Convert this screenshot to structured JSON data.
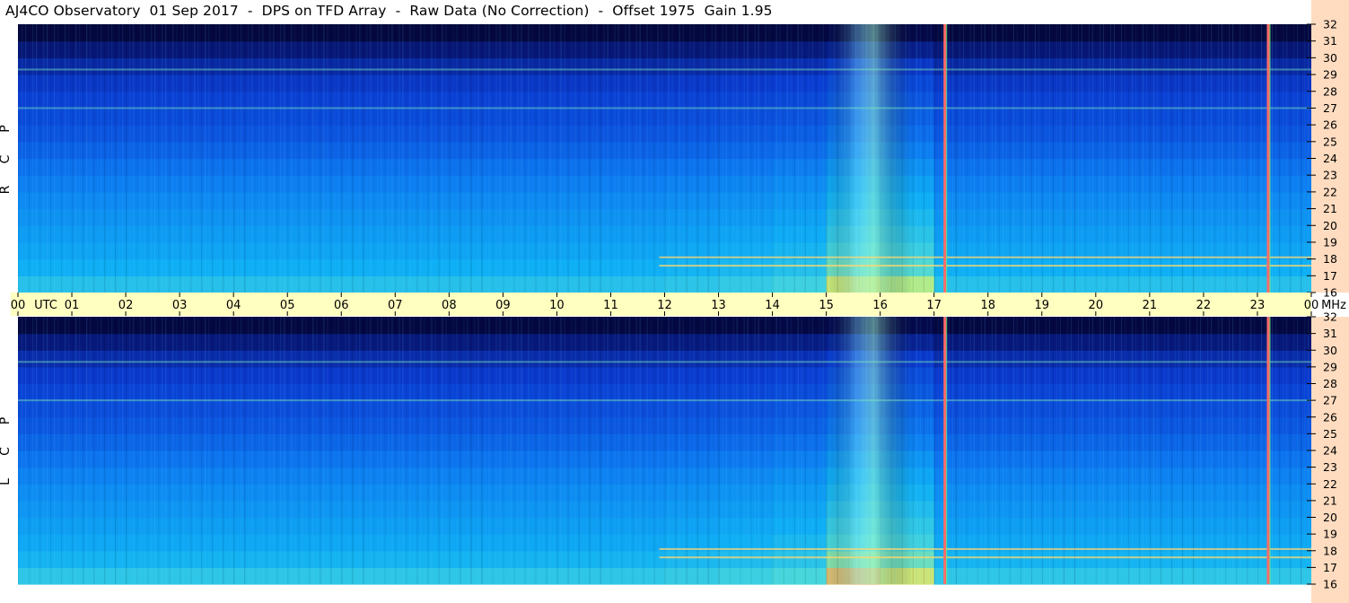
{
  "title": "AJ4CO Observatory  01 Sep 2017  -  DPS on TFD Array  -  Raw Data (No Correction)  -  Offset 1975  Gain 1.95",
  "colors": {
    "time_axis_bg": "#ffffc0",
    "freq_axis_bg": "#ffdcc0",
    "spectrum_low": "#000010",
    "spectrum_mid": "#0a64ff",
    "spectrum_high": "#ff6060",
    "interference_line": "#ff6a6a"
  },
  "chart_data": {
    "type": "heatmap",
    "title": "AJ4CO Observatory  01 Sep 2017  -  DPS on TFD Array  -  Raw Data (No Correction)  -  Offset 1975  Gain 1.95",
    "x_axis": {
      "unit_label": "UTC",
      "ticks": [
        "00",
        "01",
        "02",
        "03",
        "04",
        "05",
        "06",
        "07",
        "08",
        "09",
        "10",
        "11",
        "12",
        "13",
        "14",
        "15",
        "16",
        "17",
        "18",
        "19",
        "20",
        "21",
        "22",
        "23",
        "00"
      ],
      "range_hours": [
        0,
        24
      ]
    },
    "y_axis": {
      "unit_label": "MHz",
      "ticks": [
        "16",
        "17",
        "18",
        "19",
        "20",
        "21",
        "22",
        "23",
        "24",
        "25",
        "26",
        "27",
        "28",
        "29",
        "30",
        "31",
        "32"
      ],
      "range_mhz": [
        16,
        32
      ]
    },
    "panels": [
      {
        "name": "R C P",
        "brightness_by_frequency": [
          0.78,
          0.7,
          0.66,
          0.63,
          0.6,
          0.57,
          0.54,
          0.5,
          0.45,
          0.4,
          0.36,
          0.33,
          0.3,
          0.26,
          0.2,
          0.12,
          0.03
        ],
        "brightness_by_hour": [
          1.0,
          1.0,
          1.0,
          1.0,
          1.0,
          1.0,
          1.0,
          1.0,
          1.0,
          1.0,
          1.0,
          1.0,
          1.02,
          1.04,
          1.08,
          1.25,
          1.22,
          1.0,
          1.0,
          1.0,
          1.0,
          1.0,
          1.0,
          1.0
        ]
      },
      {
        "name": "L C P",
        "brightness_by_frequency": [
          0.8,
          0.72,
          0.67,
          0.64,
          0.61,
          0.58,
          0.55,
          0.51,
          0.46,
          0.41,
          0.37,
          0.34,
          0.31,
          0.27,
          0.21,
          0.13,
          0.03
        ],
        "brightness_by_hour": [
          1.0,
          1.0,
          1.0,
          1.0,
          1.0,
          1.0,
          1.0,
          1.0,
          1.0,
          1.0,
          1.0,
          1.0,
          1.02,
          1.04,
          1.08,
          1.25,
          1.22,
          1.0,
          1.0,
          1.0,
          1.0,
          1.0,
          1.0,
          1.0
        ]
      }
    ],
    "vertical_interference_lines_utc": [
      17.2,
      23.2
    ],
    "horizontal_bands_mhz": [
      17.6,
      18.1,
      27.0,
      29.3
    ]
  }
}
